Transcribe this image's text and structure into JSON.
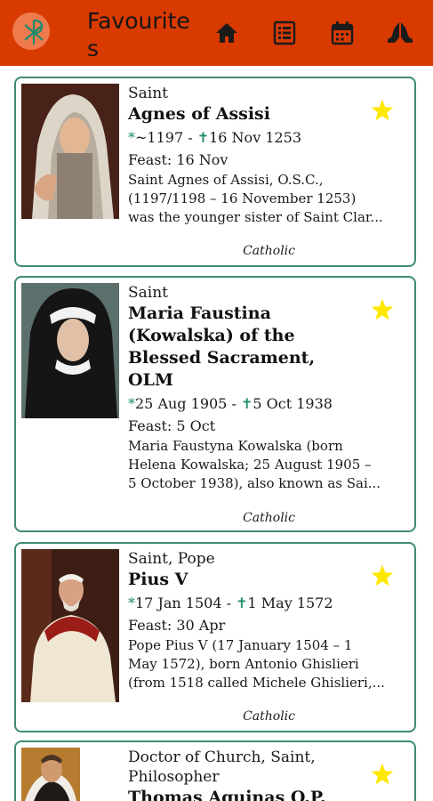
{
  "app": {
    "title": "Favourites"
  },
  "colors": {
    "appbar": "#d93a00",
    "card_border": "#3f8b77",
    "star": "#ffe800",
    "date_mark": "#1f8b6d"
  },
  "icons": [
    "home-icon",
    "list-icon",
    "calendar-icon",
    "praying-hands-icon",
    "star-icon"
  ],
  "saints": [
    {
      "type": "Saint",
      "name_lines": [
        "Agnes of Assisi"
      ],
      "birth_mark": "*",
      "birth": "~1197",
      "death_mark": "✝",
      "death": "16 Nov 1253",
      "feast": "Feast: 16 Nov",
      "desc_lines": [
        "Saint Agnes of Assisi, O.S.C.,",
        "(1197/1198 – 16 November 1253)",
        "was the younger sister of Saint Clar..."
      ],
      "church": "Catholic"
    },
    {
      "type": "Saint",
      "name_lines": [
        "Maria Faustina",
        "(Kowalska) of the",
        "Blessed Sacrament,",
        "OLM"
      ],
      "birth_mark": "*",
      "birth": "25 Aug 1905",
      "death_mark": "✝",
      "death": "5 Oct 1938",
      "feast": "Feast: 5 Oct",
      "desc_lines": [
        "Maria Faustyna Kowalska (born",
        "Helena Kowalska; 25 August 1905 –",
        "5 October 1938), also known as Sai..."
      ],
      "church": "Catholic"
    },
    {
      "type": "Saint, Pope",
      "name_lines": [
        "Pius V"
      ],
      "birth_mark": "*",
      "birth": "17 Jan 1504",
      "death_mark": "✝",
      "death": "1 May 1572",
      "feast": "Feast: 30 Apr",
      "desc_lines": [
        "Pope Pius V (17 January 1504 – 1",
        "May 1572), born Antonio Ghislieri",
        "(from 1518 called Michele Ghislieri,..."
      ],
      "church": "Catholic"
    },
    {
      "type_lines": [
        "Doctor of Church, Saint,",
        "Philosopher"
      ],
      "name_lines": [
        "Thomas Aquinas O.P."
      ]
    }
  ]
}
